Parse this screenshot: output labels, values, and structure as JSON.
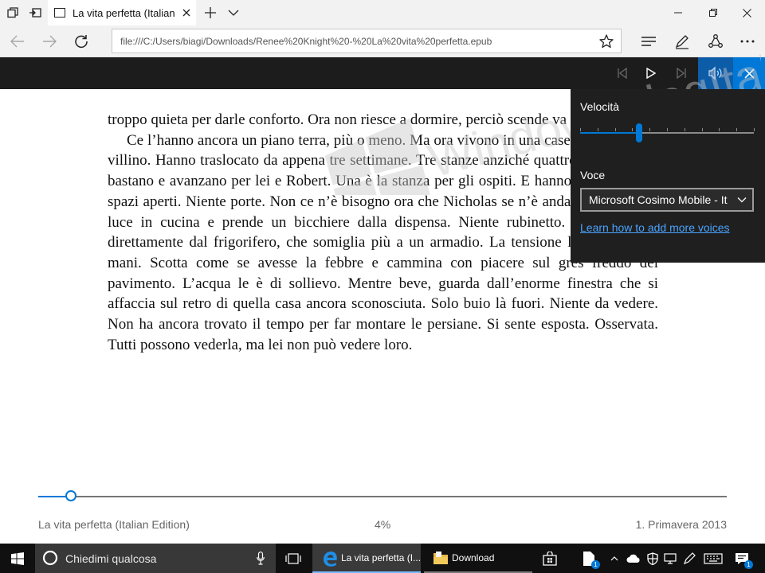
{
  "browser": {
    "tab_title": "La vita perfetta (Italian E",
    "address": "file:///C:/Users/biagi/Downloads/Renee%20Knight%20-%20La%20vita%20perfetta.epub"
  },
  "watermark": {
    "text": "WindowsBlogItalia"
  },
  "book": {
    "paragraphs": [
      "troppo quieta per darle conforto. Ora non riesce a dormire, perciò scen­de va al piano terra.",
      "Ce l’hanno ancora un piano terra, più o meno. Ma ora vivono in una casetta, non più un villino. Hanno traslocato da appena tre settimane. Tre stanze anziché quattro. Due camere bastano e avanzano per lei e Robert. Una è la stanza per gli ospiti. E hanno optato per gli spazi aperti. Niente porte. Non ce n’è bisogno ora che Nicholas se n’è andato. Accende la luce in cucina e prende un bic­chiere dalla dispensa. Niente rubinetto. Acqua fredda direttamente dal frigorifero, che somiglia più a un armadio. La tensione le fa sudare le mani. Scotta come se avesse la febbre e cammina con piacere sul grès freddo del pavimento. L’acqua le è di sollievo. Mentre beve, guarda dall’enorme finestra che si affaccia sul retro di quella casa ancora sconosciuta. Solo buio là fuori. Niente da vedere. Non ha ancora trovato il tempo per far montare le persiane. Si sente esposta. Osservata. Tutti pos­sono vederla, ma lei non può vedere loro."
    ]
  },
  "read_aloud": {
    "speed_label": "Velocità",
    "speed_fraction": 0.34,
    "speed_ticks": 10,
    "voice_label": "Voce",
    "voice_value": "Microsoft Cosimo Mobile - It",
    "more_voices_link": "Learn how to add more voices"
  },
  "footer": {
    "book_title": "La vita perfetta (Italian Edition)",
    "progress_text": "4%",
    "progress_fraction": 0.048,
    "chapter": "1. Primavera 2013"
  },
  "taskbar": {
    "search_placeholder": "Chiedimi qualcosa",
    "edge_label": "La vita perfetta (I...",
    "explorer_label": "Download",
    "store_badge": "1",
    "notification_badge": "1"
  },
  "colors": {
    "accent": "#0078d7",
    "reader_bar": "#1c1c1c",
    "flyout_bg": "#1f1f1f",
    "taskbar_bg": "#101010"
  }
}
